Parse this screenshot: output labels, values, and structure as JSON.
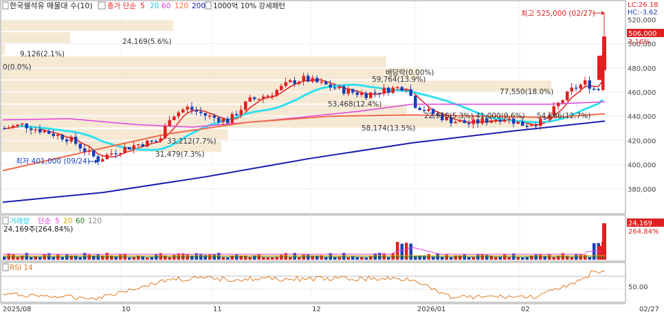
{
  "header": {
    "title": "한국쉘석유 매물대 수(10)",
    "price_ma_label": "종가 단순",
    "price_ma_periods": [
      "5",
      "20",
      "60",
      "120",
      "200"
    ],
    "overlay_label": "1000억 10% 강세패턴"
  },
  "right_info": {
    "lc": "LC:26.18",
    "hc": "HC:-3.62"
  },
  "price_axis": {
    "ticks": [
      "520,000",
      "500,000",
      "480,000",
      "460,000",
      "440,000",
      "420,000",
      "400,000",
      "380,000"
    ],
    "current_price": "506,000",
    "current_change": "3.16%"
  },
  "annotations": {
    "high": "최고 525,000 (02/27)",
    "low": "최저 401,000 (09/24)",
    "dividend": "배당락(0.00%)"
  },
  "volume_profile_labels": [
    {
      "text": "24,169(5.6%)"
    },
    {
      "text": "9,126(2.1%)"
    },
    {
      "text": "0(0.0%)"
    },
    {
      "text": "59,764(13.9%)"
    },
    {
      "text": "77,550(18.0%)"
    },
    {
      "text": "53,468(12.4%)"
    },
    {
      "text": "58,174(13.5%)"
    },
    {
      "text": "22,958(5.3%)"
    },
    {
      "text": "41,000(9.6%)"
    },
    {
      "text": "54,666(12.7%)"
    },
    {
      "text": "33,212(7.7%)"
    },
    {
      "text": "31,479(7.3%)"
    }
  ],
  "volume_panel": {
    "title": "거래량",
    "ma_label": "단순",
    "ma_periods": [
      "5",
      "20",
      "60",
      "120"
    ],
    "readout": "24,169주(264.84%)",
    "current_value": "24,169",
    "current_pct": "264.84%"
  },
  "rsi_panel": {
    "title": "RSI 14",
    "tick": "50.00"
  },
  "x_axis": {
    "labels": [
      "2025/08",
      "10",
      "11",
      "12",
      "2026/01",
      "02"
    ],
    "right_date": "02/27"
  },
  "colors": {
    "up": "#e02020",
    "down": "#1a3fb8",
    "ma5": "#e02020",
    "ma20": "#2ee0f0",
    "ma60": "#e040e0",
    "ma120": "#f06a4a",
    "ma200": "#1a1ab0",
    "profile": "#f5e5cc",
    "rsi": "#e07a20"
  },
  "chart_data": {
    "type": "candlestick",
    "ylim": [
      360000,
      535000
    ],
    "high_point": {
      "date": "02/27",
      "value": 525000
    },
    "low_point": {
      "date": "09/24",
      "value": 401000
    },
    "last_close": 506000,
    "last_change_pct": 3.16,
    "last_volume": 24169,
    "volume_ma_periods": [
      5,
      20,
      60,
      120
    ],
    "rsi_period": 14
  }
}
